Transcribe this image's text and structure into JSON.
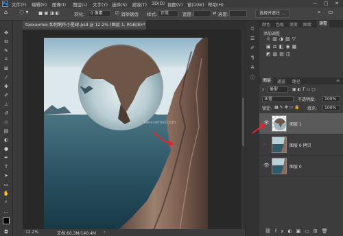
{
  "app": {
    "logo": "Ps"
  },
  "menubar": {
    "items": [
      "文件(F)",
      "编辑(E)",
      "图像(I)",
      "图层(L)",
      "文字(Y)",
      "选择(S)",
      "滤镜(T)",
      "3D(D)",
      "视图(V)",
      "窗口(W)",
      "帮助(H)"
    ],
    "window_controls": [
      "—",
      "□",
      "✕"
    ]
  },
  "options_bar": {
    "feather_label": "羽化:",
    "feather_value": "0 像素",
    "antialias_label": "消除锯齿",
    "style_label": "样式:",
    "style_value": "正常",
    "width_label": "宽度:",
    "height_label": "高度:",
    "select_mask_button": "选择并遮住 ..."
  },
  "document_tab": {
    "title": "taoxuemei-如何制作小星球.psd @ 12.2% (图层 1, RGB/8) *",
    "close": "×"
  },
  "status": {
    "zoom": "12.2%",
    "doc_size": "文档:60.3M/140.4M"
  },
  "watermark": "taoxuemei.com",
  "panels": {
    "top_tabs": [
      "颜色",
      "色板",
      "渐变",
      "图案",
      "调整"
    ],
    "active_top_tab": "调整",
    "adjust_title": "添加调整",
    "layer_tabs": [
      "图层",
      "通道",
      "路径"
    ],
    "active_layer_tab": "图层",
    "kind_label": "类型",
    "blend_mode": "正常",
    "opacity_label": "不透明度:",
    "opacity_value": "100%",
    "lock_label": "锁定:",
    "fill_label": "填充:",
    "fill_value": "100%",
    "layers": [
      {
        "name": "图层 1",
        "visible": true,
        "selected": true
      },
      {
        "name": "图层 0 拷贝",
        "visible": false,
        "selected": false
      },
      {
        "name": "图层 0",
        "visible": true,
        "selected": false
      }
    ]
  },
  "colors": {
    "accent": "#31a8ff",
    "selected_layer": "#5a5a5a",
    "arrow": "#e0262e"
  }
}
